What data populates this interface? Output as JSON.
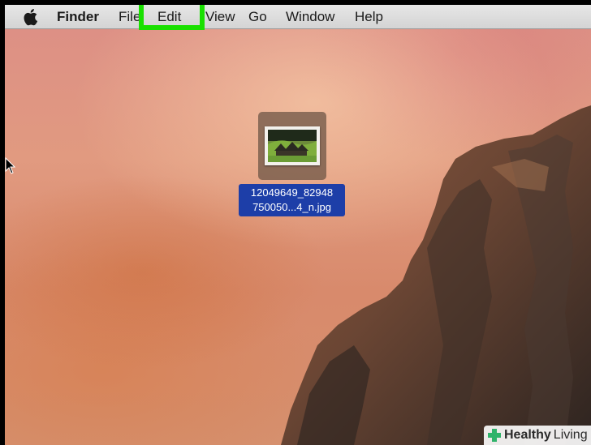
{
  "menubar": {
    "app_name": "Finder",
    "items": [
      "File",
      "Edit",
      "View",
      "Go",
      "Window",
      "Help"
    ],
    "highlighted": "Edit"
  },
  "desktop": {
    "file": {
      "label_line1": "12049649_82948",
      "label_line2": "750050...4_n.jpg"
    }
  },
  "watermark": {
    "word1": "Healthy",
    "word2": "Living"
  },
  "colors": {
    "highlight": "#19e000",
    "selection": "#1d3ea8"
  }
}
